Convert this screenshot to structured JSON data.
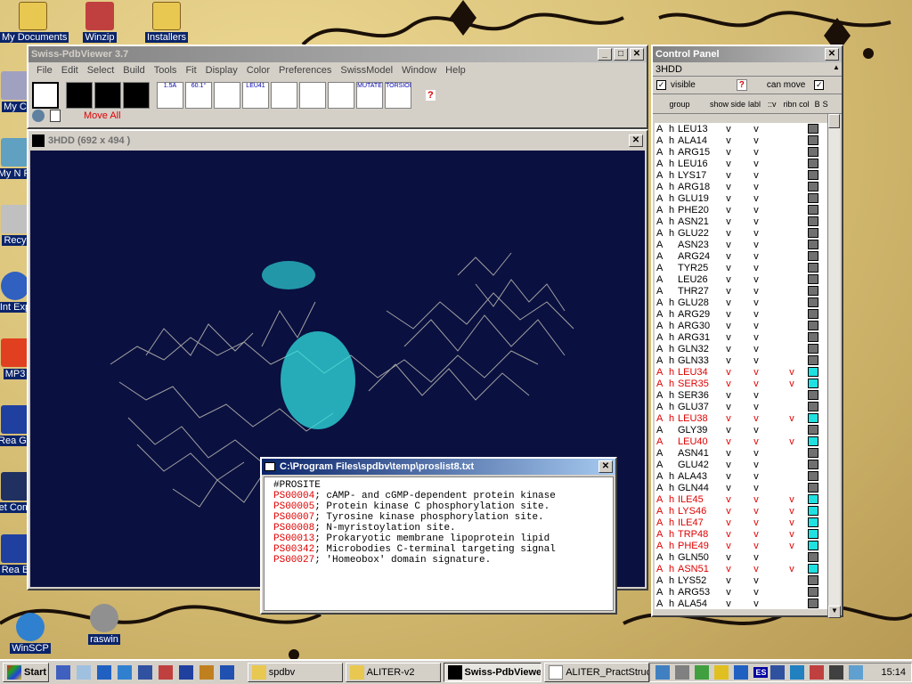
{
  "desktop": {
    "icons": [
      {
        "label": "My Documents",
        "name": "my-documents-icon"
      },
      {
        "label": "Winzip",
        "name": "winzip-icon"
      },
      {
        "label": "Installers",
        "name": "installers-folder-icon"
      },
      {
        "label": "My C",
        "name": "my-computer-icon"
      },
      {
        "label": "My N Pl",
        "name": "network-places-icon"
      },
      {
        "label": "Recy",
        "name": "recycle-bin-icon"
      },
      {
        "label": "Int Exp",
        "name": "internet-explorer-icon"
      },
      {
        "label": "MP3",
        "name": "mp3-icon"
      },
      {
        "label": "Rea Ga",
        "name": "real-player-icon"
      },
      {
        "label": "Net Comm",
        "name": "net-comm-icon"
      },
      {
        "label": "Rea B",
        "name": "real-b-icon"
      },
      {
        "label": "WinSCP",
        "name": "winscp-icon"
      },
      {
        "label": "raswin",
        "name": "raswin-icon"
      }
    ]
  },
  "spdbv": {
    "title": "Swiss-PdbViewer 3.7",
    "menu": [
      "File",
      "Edit",
      "Select",
      "Build",
      "Tools",
      "Fit",
      "Display",
      "Color",
      "Preferences",
      "SwissModel",
      "Window",
      "Help"
    ],
    "tools": [
      "",
      "",
      "",
      "",
      "1.5Å",
      "60.1°",
      "",
      "LEU41",
      "",
      "",
      "",
      "MUTATE",
      "TORSION"
    ],
    "move_all": "Move All",
    "help_btn": "?"
  },
  "viewer": {
    "title": "3HDD  (692 x 494 )",
    "background_color": "#0a1040"
  },
  "proslist": {
    "title": "C:\\Program Files\\spdbv\\temp\\proslist8.txt",
    "header": "#PROSITE",
    "entries": [
      {
        "code": "PS00004",
        "desc": "; cAMP- and cGMP-dependent protein kinase"
      },
      {
        "code": "PS00005",
        "desc": "; Protein kinase C phosphorylation site."
      },
      {
        "code": "PS00007",
        "desc": "; Tyrosine kinase phosphorylation site."
      },
      {
        "code": "PS00008",
        "desc": "; N-myristoylation site."
      },
      {
        "code": "PS00013",
        "desc": "; Prokaryotic membrane lipoprotein lipid"
      },
      {
        "code": "PS00342",
        "desc": "; Microbodies C-terminal targeting signal"
      },
      {
        "code": "PS00027",
        "desc": "; 'Homeobox' domain signature."
      }
    ]
  },
  "control_panel": {
    "title": "Control Panel",
    "molecule": "3HDD",
    "visible_label": "visible",
    "can_move_label": "can move",
    "help": "?",
    "col_group": "group",
    "col_show_side": "show side",
    "col_labl": "labl",
    "col_v": "::v",
    "col_ribn": "ribn col",
    "col_b": "B",
    "col_s": "S",
    "rows": [
      {
        "chain": "A",
        "h": "h",
        "res": "LEU13",
        "v1": "v",
        "v2": "v",
        "v3": "",
        "red": false,
        "box": "#707070"
      },
      {
        "chain": "A",
        "h": "h",
        "res": "ALA14",
        "v1": "v",
        "v2": "v",
        "v3": "",
        "red": false,
        "box": "#707070"
      },
      {
        "chain": "A",
        "h": "h",
        "res": "ARG15",
        "v1": "v",
        "v2": "v",
        "v3": "",
        "red": false,
        "box": "#707070"
      },
      {
        "chain": "A",
        "h": "h",
        "res": "LEU16",
        "v1": "v",
        "v2": "v",
        "v3": "",
        "red": false,
        "box": "#707070"
      },
      {
        "chain": "A",
        "h": "h",
        "res": "LYS17",
        "v1": "v",
        "v2": "v",
        "v3": "",
        "red": false,
        "box": "#707070"
      },
      {
        "chain": "A",
        "h": "h",
        "res": "ARG18",
        "v1": "v",
        "v2": "v",
        "v3": "",
        "red": false,
        "box": "#707070"
      },
      {
        "chain": "A",
        "h": "h",
        "res": "GLU19",
        "v1": "v",
        "v2": "v",
        "v3": "",
        "red": false,
        "box": "#707070"
      },
      {
        "chain": "A",
        "h": "h",
        "res": "PHE20",
        "v1": "v",
        "v2": "v",
        "v3": "",
        "red": false,
        "box": "#707070"
      },
      {
        "chain": "A",
        "h": "h",
        "res": "ASN21",
        "v1": "v",
        "v2": "v",
        "v3": "",
        "red": false,
        "box": "#707070"
      },
      {
        "chain": "A",
        "h": "h",
        "res": "GLU22",
        "v1": "v",
        "v2": "v",
        "v3": "",
        "red": false,
        "box": "#707070"
      },
      {
        "chain": "A",
        "h": "",
        "res": "ASN23",
        "v1": "v",
        "v2": "v",
        "v3": "",
        "red": false,
        "box": "#707070"
      },
      {
        "chain": "A",
        "h": "",
        "res": "ARG24",
        "v1": "v",
        "v2": "v",
        "v3": "",
        "red": false,
        "box": "#707070"
      },
      {
        "chain": "A",
        "h": "",
        "res": "TYR25",
        "v1": "v",
        "v2": "v",
        "v3": "",
        "red": false,
        "box": "#707070"
      },
      {
        "chain": "A",
        "h": "",
        "res": "LEU26",
        "v1": "v",
        "v2": "v",
        "v3": "",
        "red": false,
        "box": "#707070"
      },
      {
        "chain": "A",
        "h": "",
        "res": "THR27",
        "v1": "v",
        "v2": "v",
        "v3": "",
        "red": false,
        "box": "#707070"
      },
      {
        "chain": "A",
        "h": "h",
        "res": "GLU28",
        "v1": "v",
        "v2": "v",
        "v3": "",
        "red": false,
        "box": "#707070"
      },
      {
        "chain": "A",
        "h": "h",
        "res": "ARG29",
        "v1": "v",
        "v2": "v",
        "v3": "",
        "red": false,
        "box": "#707070"
      },
      {
        "chain": "A",
        "h": "h",
        "res": "ARG30",
        "v1": "v",
        "v2": "v",
        "v3": "",
        "red": false,
        "box": "#707070"
      },
      {
        "chain": "A",
        "h": "h",
        "res": "ARG31",
        "v1": "v",
        "v2": "v",
        "v3": "",
        "red": false,
        "box": "#707070"
      },
      {
        "chain": "A",
        "h": "h",
        "res": "GLN32",
        "v1": "v",
        "v2": "v",
        "v3": "",
        "red": false,
        "box": "#707070"
      },
      {
        "chain": "A",
        "h": "h",
        "res": "GLN33",
        "v1": "v",
        "v2": "v",
        "v3": "",
        "red": false,
        "box": "#707070"
      },
      {
        "chain": "A",
        "h": "h",
        "res": "LEU34",
        "v1": "v",
        "v2": "v",
        "v3": "v",
        "red": true,
        "box": "#20e0e0"
      },
      {
        "chain": "A",
        "h": "h",
        "res": "SER35",
        "v1": "v",
        "v2": "v",
        "v3": "v",
        "red": true,
        "box": "#20e0e0"
      },
      {
        "chain": "A",
        "h": "h",
        "res": "SER36",
        "v1": "v",
        "v2": "v",
        "v3": "",
        "red": false,
        "box": "#707070"
      },
      {
        "chain": "A",
        "h": "h",
        "res": "GLU37",
        "v1": "v",
        "v2": "v",
        "v3": "",
        "red": false,
        "box": "#707070"
      },
      {
        "chain": "A",
        "h": "h",
        "res": "LEU38",
        "v1": "v",
        "v2": "v",
        "v3": "v",
        "red": true,
        "box": "#20e0e0"
      },
      {
        "chain": "A",
        "h": "",
        "res": "GLY39",
        "v1": "v",
        "v2": "v",
        "v3": "",
        "red": false,
        "box": "#707070"
      },
      {
        "chain": "A",
        "h": "",
        "res": "LEU40",
        "v1": "v",
        "v2": "v",
        "v3": "v",
        "red": true,
        "box": "#20e0e0"
      },
      {
        "chain": "A",
        "h": "",
        "res": "ASN41",
        "v1": "v",
        "v2": "v",
        "v3": "",
        "red": false,
        "box": "#707070"
      },
      {
        "chain": "A",
        "h": "",
        "res": "GLU42",
        "v1": "v",
        "v2": "v",
        "v3": "",
        "red": false,
        "box": "#707070"
      },
      {
        "chain": "A",
        "h": "h",
        "res": "ALA43",
        "v1": "v",
        "v2": "v",
        "v3": "",
        "red": false,
        "box": "#707070"
      },
      {
        "chain": "A",
        "h": "h",
        "res": "GLN44",
        "v1": "v",
        "v2": "v",
        "v3": "",
        "red": false,
        "box": "#707070"
      },
      {
        "chain": "A",
        "h": "h",
        "res": "ILE45",
        "v1": "v",
        "v2": "v",
        "v3": "v",
        "red": true,
        "box": "#20e0e0"
      },
      {
        "chain": "A",
        "h": "h",
        "res": "LYS46",
        "v1": "v",
        "v2": "v",
        "v3": "v",
        "red": true,
        "box": "#20e0e0"
      },
      {
        "chain": "A",
        "h": "h",
        "res": "ILE47",
        "v1": "v",
        "v2": "v",
        "v3": "v",
        "red": true,
        "box": "#20e0e0"
      },
      {
        "chain": "A",
        "h": "h",
        "res": "TRP48",
        "v1": "v",
        "v2": "v",
        "v3": "v",
        "red": true,
        "box": "#20e0e0"
      },
      {
        "chain": "A",
        "h": "h",
        "res": "PHE49",
        "v1": "v",
        "v2": "v",
        "v3": "v",
        "red": true,
        "box": "#20e0e0"
      },
      {
        "chain": "A",
        "h": "h",
        "res": "GLN50",
        "v1": "v",
        "v2": "v",
        "v3": "",
        "red": false,
        "box": "#707070"
      },
      {
        "chain": "A",
        "h": "h",
        "res": "ASN51",
        "v1": "v",
        "v2": "v",
        "v3": "v",
        "red": true,
        "box": "#20e0e0"
      },
      {
        "chain": "A",
        "h": "h",
        "res": "LYS52",
        "v1": "v",
        "v2": "v",
        "v3": "",
        "red": false,
        "box": "#707070"
      },
      {
        "chain": "A",
        "h": "h",
        "res": "ARG53",
        "v1": "v",
        "v2": "v",
        "v3": "",
        "red": false,
        "box": "#707070"
      },
      {
        "chain": "A",
        "h": "h",
        "res": "ALA54",
        "v1": "v",
        "v2": "v",
        "v3": "",
        "red": false,
        "box": "#707070"
      }
    ]
  },
  "taskbar": {
    "start": "Start",
    "tasks": [
      {
        "label": "spdbv",
        "pressed": false
      },
      {
        "label": "ALITER-v2",
        "pressed": false
      },
      {
        "label": "Swiss-PdbViewe...",
        "pressed": true
      },
      {
        "label": "ALITER_PractStruc",
        "pressed": false
      }
    ],
    "tray_lang": "ES",
    "clock": "15:14"
  }
}
